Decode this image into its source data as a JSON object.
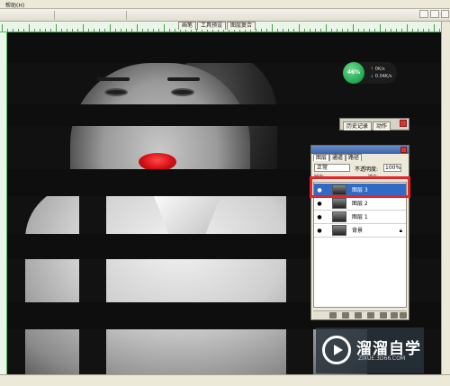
{
  "menu": {
    "help_label": "帮助(H)"
  },
  "palette_well": {
    "tabs": [
      "画笔",
      "工具预设",
      "图层复合"
    ]
  },
  "speed_widget": {
    "percent": "46%",
    "up_rate": "0K/s",
    "down_rate": "0.04K/s"
  },
  "history_palette": {
    "tabs": [
      "历史记录",
      "动作"
    ]
  },
  "layers_panel": {
    "tabs": [
      "图层",
      "通道",
      "路径"
    ],
    "blend_mode": "正常",
    "opacity_label": "不透明度:",
    "opacity_value": "100%",
    "lock_label": "锁定:",
    "fill_label": "填充:",
    "layers": [
      {
        "name": "图层 3",
        "selected": true,
        "locked": false
      },
      {
        "name": "图层 2",
        "selected": false,
        "locked": false
      },
      {
        "name": "图层 1",
        "selected": false,
        "locked": false
      },
      {
        "name": "背景",
        "selected": false,
        "locked": true
      }
    ],
    "highlight_color": "#e8232a",
    "selected_color": "#316ac5"
  },
  "watermark": {
    "brand": "溜溜自学",
    "url": "ZIXUE.3D66.COM"
  },
  "status_bar": {
    "text": ""
  },
  "colors": {
    "ruler_green": "#5fb060",
    "lip_red": "#d40f14"
  }
}
